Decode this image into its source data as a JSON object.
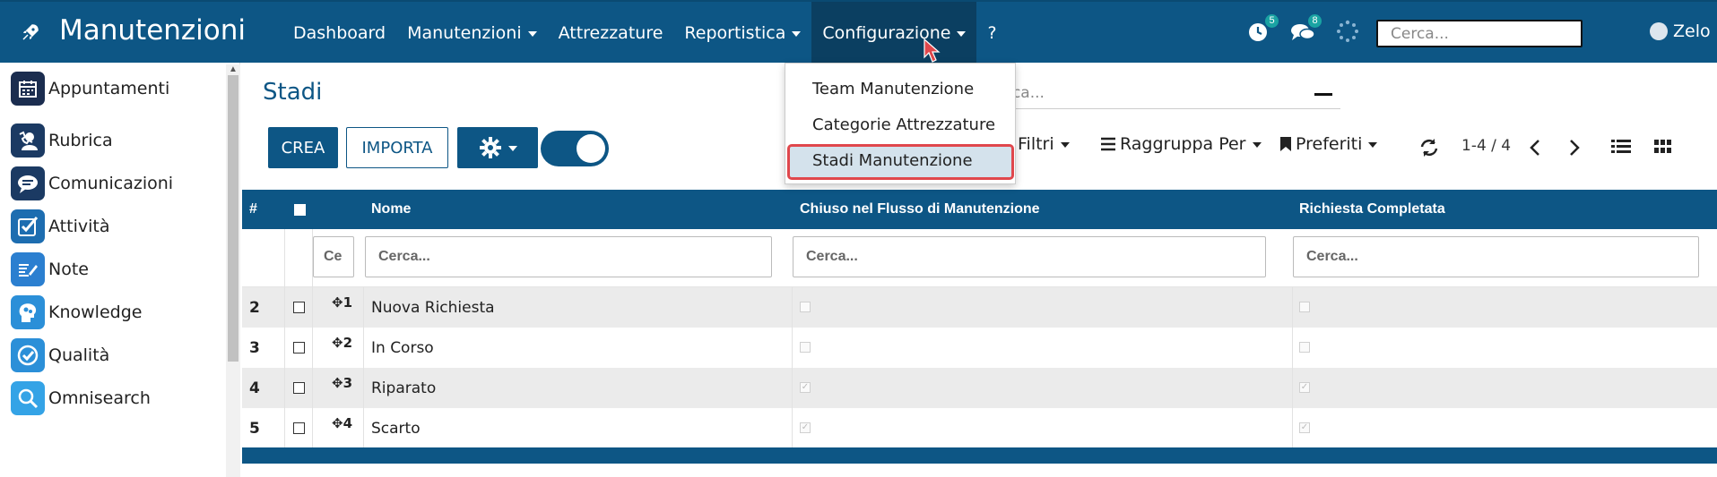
{
  "app": {
    "title": "Manutenzioni"
  },
  "nav": {
    "items": [
      {
        "label": "Dashboard",
        "has_caret": false
      },
      {
        "label": "Manutenzioni",
        "has_caret": true
      },
      {
        "label": "Attrezzature",
        "has_caret": false
      },
      {
        "label": "Reportistica",
        "has_caret": true
      },
      {
        "label": "Configurazione",
        "has_caret": true
      },
      {
        "label": "?",
        "has_caret": false
      }
    ]
  },
  "top_icons": {
    "activity_badge": "5",
    "chat_badge": "8"
  },
  "top_search": {
    "placeholder": "Cerca..."
  },
  "user": {
    "name": "Zelo"
  },
  "sidebar": {
    "items": [
      {
        "label": "Appuntamenti",
        "icon": "calendar-icon"
      },
      {
        "label": "Rubrica",
        "icon": "contacts-icon"
      },
      {
        "label": "Comunicazioni",
        "icon": "chat-icon"
      },
      {
        "label": "Attività",
        "icon": "check-icon"
      },
      {
        "label": "Note",
        "icon": "note-icon"
      },
      {
        "label": "Knowledge",
        "icon": "brain-icon"
      },
      {
        "label": "Qualità",
        "icon": "quality-icon"
      },
      {
        "label": "Omnisearch",
        "icon": "search-icon"
      }
    ]
  },
  "page": {
    "title": "Stadi"
  },
  "toolbar": {
    "create_label": "CREA",
    "import_label": "IMPORTA",
    "search_placeholder": "Cerca...",
    "filters_label": "Filtri",
    "groupby_label": "Raggruppa Per",
    "favorites_label": "Preferiti",
    "pager": "1-4 / 4"
  },
  "dropdown": {
    "items": [
      {
        "label": "Team Manutenzione"
      },
      {
        "label": "Categorie Attrezzature"
      },
      {
        "label": "Stadi Manutenzione"
      }
    ]
  },
  "table": {
    "headers": {
      "num": "#",
      "name": "Nome",
      "closed": "Chiuso nel Flusso di Manutenzione",
      "done": "Richiesta Completata"
    },
    "filters": {
      "seq": "Ce",
      "name": "Cerca...",
      "closed": "Cerca...",
      "done": "Cerca..."
    },
    "rows": [
      {
        "num": "2",
        "seq": "1",
        "name": "Nuova Richiesta",
        "closed": false,
        "done": false
      },
      {
        "num": "3",
        "seq": "2",
        "name": "In Corso",
        "closed": false,
        "done": false
      },
      {
        "num": "4",
        "seq": "3",
        "name": "Riparato",
        "closed": true,
        "done": true
      },
      {
        "num": "5",
        "seq": "4",
        "name": "Scarto",
        "closed": true,
        "done": true
      }
    ]
  },
  "colors": {
    "primary": "#0d5685",
    "highlight_border": "#e0474c"
  }
}
